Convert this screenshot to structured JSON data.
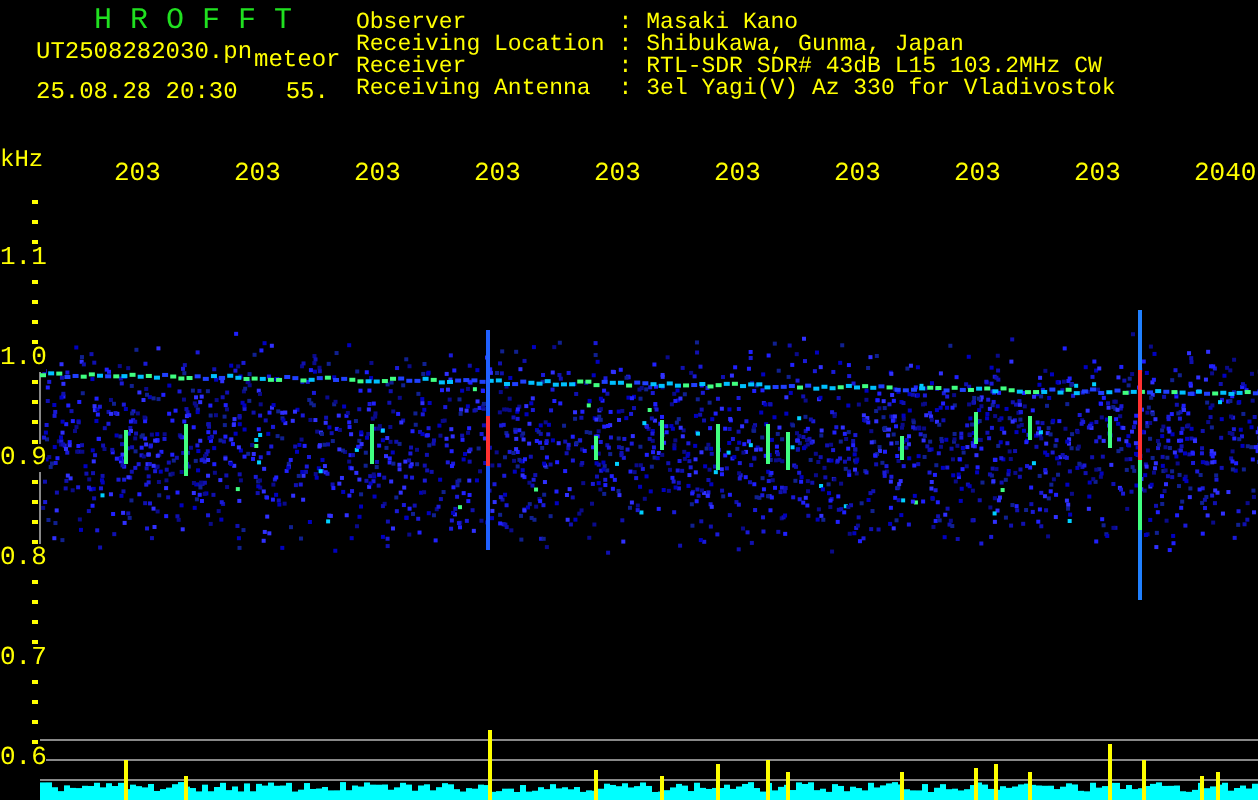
{
  "header": {
    "title": "H R O F F T",
    "file_name": "UT2508282030.pn",
    "tag": "meteor",
    "timestamp": "25.08.28 20:30",
    "count": "55.",
    "station": [
      {
        "label": "Observer",
        "colon": ":",
        "value": "Masaki Kano"
      },
      {
        "label": "Receiving Location",
        "colon": ":",
        "value": "Shibukawa, Gunma, Japan"
      },
      {
        "label": "Receiver",
        "colon": ":",
        "value": "RTL-SDR SDR# 43dB L15 103.2MHz CW"
      },
      {
        "label": "Receiving Antenna",
        "colon": ":",
        "value": "3el Yagi(V) Az 330 for Vladivostok"
      }
    ]
  },
  "x_axis": {
    "unit": "kHz",
    "labels": [
      "203",
      "203",
      "203",
      "203",
      "203",
      "203",
      "203",
      "203",
      "203",
      "2040"
    ]
  },
  "y_axis": {
    "labels": [
      "1.1",
      "1.0",
      "0.9",
      "0.8",
      "0.7",
      "0.6"
    ]
  }
}
